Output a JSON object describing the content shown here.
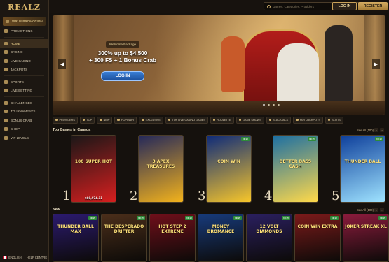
{
  "logo": "REALZ",
  "sidebar": {
    "items": [
      {
        "label": "VIRUS PROMOTION",
        "kind": "promo"
      },
      {
        "label": "PROMOTIONS",
        "kind": "normal"
      },
      {
        "label": "HOME",
        "kind": "active"
      },
      {
        "label": "CASINO",
        "kind": "normal"
      },
      {
        "label": "LIVE CASINO",
        "kind": "normal"
      },
      {
        "label": "JACKPOTS",
        "kind": "normal"
      },
      {
        "label": "SPORTS",
        "kind": "normal"
      },
      {
        "label": "LIVE BETTING",
        "kind": "normal"
      },
      {
        "label": "CHALLENGES",
        "kind": "normal"
      },
      {
        "label": "TOURNAMENTS",
        "kind": "normal"
      },
      {
        "label": "BONUS CRAB",
        "kind": "normal"
      },
      {
        "label": "SHOP",
        "kind": "normal"
      },
      {
        "label": "VIP LEVELS",
        "kind": "normal"
      }
    ],
    "footer": {
      "language": "ENGLISH",
      "help": "HELP CENTRE"
    }
  },
  "header": {
    "search_placeholder": "Games, Categories, Providers",
    "login_label": "LOG IN",
    "register_label": "REGISTER"
  },
  "hero": {
    "badge": "Welcome Package",
    "line1": "300% up to $4,500",
    "line2": "+ 300 FS + 1 Bonus Crab",
    "cta": "LOG IN"
  },
  "categories": [
    "PROVIDERS",
    "TOP",
    "NEW",
    "POPULAR",
    "EXCLUSIVE",
    "TOP LIVE CASINO GAMES",
    "ROULETTE",
    "GAME SHOWS",
    "BLACKJACK",
    "HOT JACKPOTS",
    "SLOTS"
  ],
  "top_games": {
    "title": "Top Games in Canada",
    "see_all": "See All (100)",
    "games": [
      {
        "rank": "1",
        "name": "100 SUPER HOT",
        "amount": "$66,974.11",
        "bg": "#1a1717",
        "accent": "#d61f1f"
      },
      {
        "rank": "2",
        "name": "3 APEX TREASURES",
        "amount": "",
        "bg": "#24285a",
        "accent": "#f2b21c"
      },
      {
        "rank": "3",
        "name": "COIN WIN",
        "amount": "",
        "bg": "#0d2a7a",
        "accent": "#f7c62a"
      },
      {
        "rank": "4",
        "name": "BETTER BASS CASH",
        "amount": "",
        "bg": "#1c6fa3",
        "accent": "#ffd94a"
      },
      {
        "rank": "5",
        "name": "THUNDER BALL",
        "amount": "",
        "bg": "#0e3f9b",
        "accent": "#9fe3ff"
      }
    ]
  },
  "new_games": {
    "title": "New",
    "see_all": "See All (100)",
    "games": [
      {
        "name": "THUNDER BALL MAX",
        "bg": "#2b1a6e"
      },
      {
        "name": "THE DESPERADO DRIFTER",
        "bg": "#4a2e1a"
      },
      {
        "name": "HOT STEP 2 EXTREME",
        "bg": "#6e0f1a"
      },
      {
        "name": "MONEY BROMANCE",
        "bg": "#173a7a"
      },
      {
        "name": "12 VOLT DIAMONDS",
        "bg": "#2a1f5e"
      },
      {
        "name": "COIN WIN EXTRA",
        "bg": "#7a1a1a"
      },
      {
        "name": "JOKER STREAK XL",
        "bg": "#8a1b3c"
      }
    ]
  },
  "new_badge": "NEW"
}
